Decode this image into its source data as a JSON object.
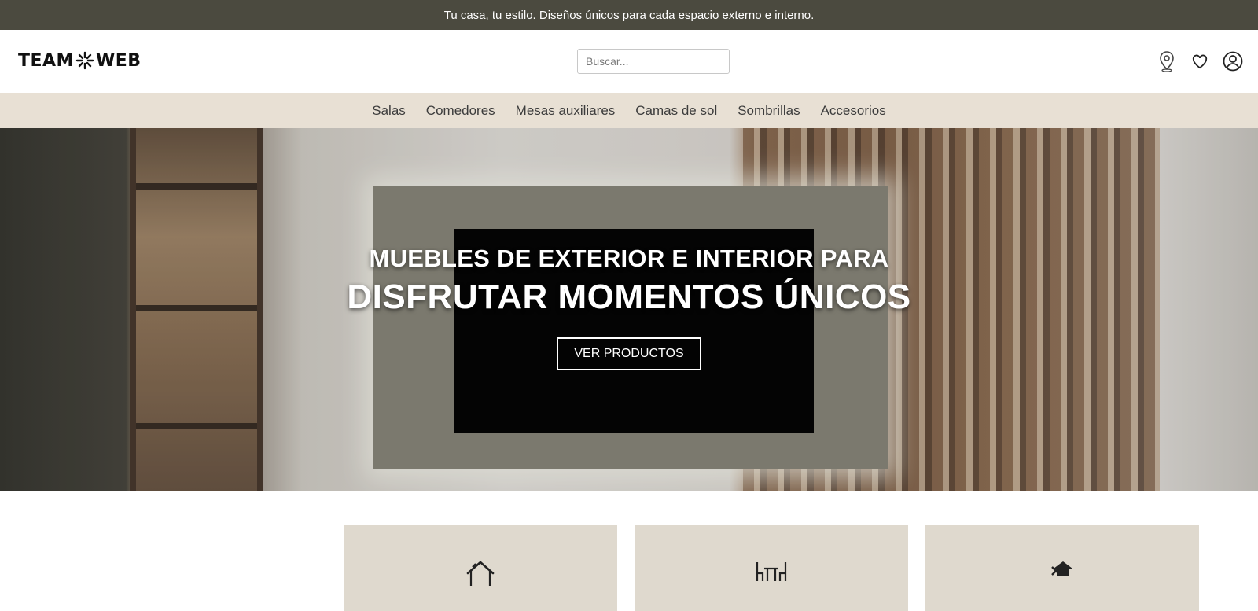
{
  "announcement": "Tu casa, tu estilo. Diseños únicos para cada espacio externo e interno.",
  "logo": {
    "left": "TEAM",
    "right": "WEB"
  },
  "search": {
    "placeholder": "Buscar..."
  },
  "header_icons": [
    "location-pin-icon",
    "heart-icon",
    "user-account-icon"
  ],
  "nav": {
    "items": [
      {
        "label": "Salas"
      },
      {
        "label": "Comedores"
      },
      {
        "label": "Mesas auxiliares"
      },
      {
        "label": "Camas de sol"
      },
      {
        "label": "Sombrillas"
      },
      {
        "label": "Accesorios"
      }
    ]
  },
  "hero": {
    "line1": "MUEBLES DE EXTERIOR E INTERIOR PARA",
    "line2": "DISFRUTAR MOMENTOS ÚNICOS",
    "button": "VER PRODUCTOS"
  },
  "category_cards": [
    {
      "icon": "house-icon"
    },
    {
      "icon": "dining-table-icon"
    },
    {
      "icon": "house-tools-icon"
    }
  ],
  "colors": {
    "announcement_bg": "#4b4a3f",
    "nav_bg": "#e8e0d4",
    "card_bg": "#dfd9ce"
  }
}
